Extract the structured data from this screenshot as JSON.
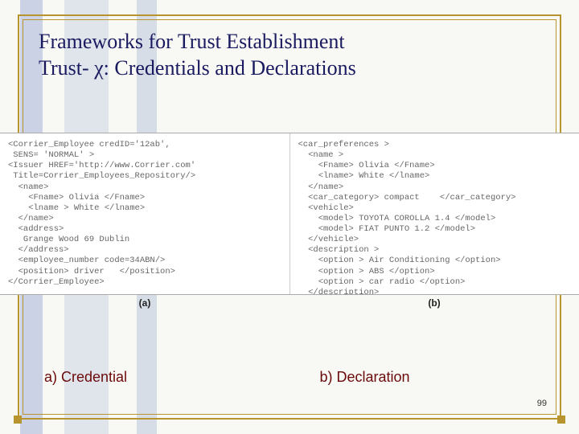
{
  "title_line1": "Frameworks for Trust Establishment",
  "title_line2": "Trust- χ: Credentials and Declarations",
  "code_left": "<Corrier_Employee credID='12ab',\n SENS= 'NORMAL' >\n<Issuer HREF='http://www.Corrier.com'\n Title=Corrier_Employees_Repository/>\n  <name>\n    <Fname> Olivia </Fname>\n    <lname > White </lname>\n  </name>\n  <address>\n   Grange Wood 69 Dublin\n  </address>\n  <employee_number code=34ABN/>\n  <position> driver   </position>\n</Corrier_Employee>",
  "code_right": "<car_preferences >\n  <name >\n    <Fname> Olivia </Fname>\n    <lname> White </lname>\n  </name>\n  <car_category> compact    </car_category>\n  <vehicle>\n    <model> TOYOTA COROLLA 1.4 </model>\n    <model> FIAT PUNTO 1.2 </model>\n  </vehicle>\n  <description >\n    <option > Air Conditioning </option>\n    <option > ABS </option>\n    <option > car radio </option>\n  </description>\n</car_preferences>",
  "fig_a": "(a)",
  "fig_b": "(b)",
  "label_a": "a) Credential",
  "label_b": "b) Declaration",
  "page": "99"
}
